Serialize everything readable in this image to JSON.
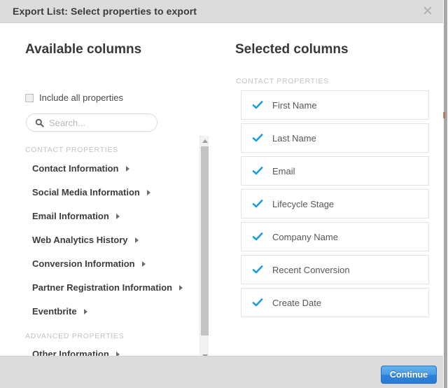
{
  "dialog": {
    "title": "Export List: Select properties to export",
    "close_icon": "close-icon"
  },
  "left_panel": {
    "heading": "Available columns",
    "include_all": {
      "label": "Include all properties",
      "checked": false
    },
    "search": {
      "placeholder": "Search...",
      "value": "",
      "icon": "search-icon"
    },
    "sections": [
      {
        "label": "CONTACT PROPERTIES",
        "items": [
          "Contact Information",
          "Social Media Information",
          "Email Information",
          "Web Analytics History",
          "Conversion Information",
          "Partner Registration Information",
          "Eventbrite"
        ]
      },
      {
        "label": "ADVANCED PROPERTIES",
        "items": [
          "Other Information"
        ]
      }
    ],
    "scrollbar": {
      "up_arrow_icon": "caret-up-icon",
      "down_arrow_icon": "caret-down-icon"
    }
  },
  "right_panel": {
    "heading": "Selected columns",
    "section_label": "CONTACT PROPERTIES",
    "items": [
      "First Name",
      "Last Name",
      "Email",
      "Lifecycle Stage",
      "Company Name",
      "Recent Conversion",
      "Create Date"
    ]
  },
  "footer": {
    "continue_label": "Continue"
  },
  "colors": {
    "header_bg": "#dcdcdc",
    "check_blue": "#1a9ee0",
    "button_blue": "#3b8edc",
    "heading_text": "#383838",
    "section_label": "#c3c3c3"
  }
}
